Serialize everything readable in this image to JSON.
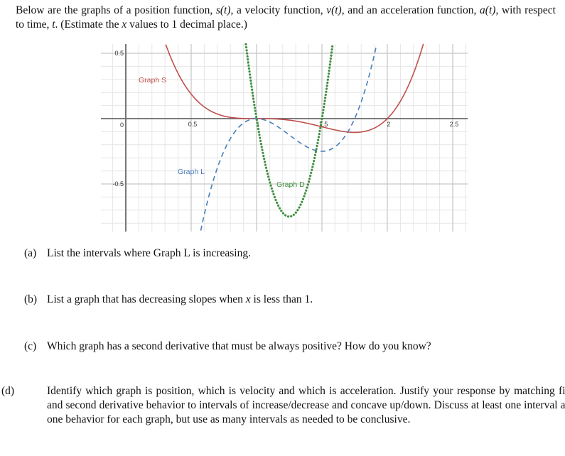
{
  "intro": {
    "line1_pre": "Below are the graphs of a position function, ",
    "s_fn": "s(t)",
    "line1_mid1": ", a velocity function, ",
    "v_fn": "v(t)",
    "line1_mid2": ", and an acceleration function, ",
    "a_fn": "a(t)",
    "line1_mid3": ", with respect to time, ",
    "t_var": "t",
    "line1_post": ". (Estimate the ",
    "x_var": "x",
    "line1_end": " values to 1 decimal place.)"
  },
  "questions": [
    {
      "label": "(a)",
      "text": "List the intervals where Graph L is increasing."
    },
    {
      "label": "(b)",
      "text_pre": "List a graph that has decreasing slopes when ",
      "var": "x",
      "text_post": " is less than 1."
    },
    {
      "label": "(c)",
      "text": "Which graph has a second derivative that must be always positive? How do you know?"
    },
    {
      "label": "(d)",
      "text": "Identify which graph is position, which is velocity and which is acceleration. Justify your response by matching first and second derivative behavior to intervals of increase/decrease and concave up/down. Discuss at least one interval and one behavior for each graph, but use as many intervals as needed to be conclusive."
    }
  ],
  "chart_data": {
    "type": "line",
    "title": "",
    "xlabel": "",
    "ylabel": "",
    "xlim": [
      -0.2,
      2.6
    ],
    "ylim": [
      -0.85,
      0.57
    ],
    "grid": true,
    "minor_grid_step": 0.1,
    "x_ticks": [
      "0.5",
      "1",
      "1.5",
      "2",
      "2.5"
    ],
    "x_tick_values": [
      0.5,
      1,
      1.5,
      2,
      2.5
    ],
    "y_ticks": [
      "0.5",
      "0",
      "-0.5"
    ],
    "y_tick_values": [
      0.5,
      0,
      -0.5
    ],
    "series": [
      {
        "name": "Graph S",
        "style": "solid",
        "color": "#c0504d",
        "formula": "(x-1)^3*(x-2)",
        "x": [
          0.3,
          0.5,
          0.75,
          1.0,
          1.25,
          1.5,
          1.75,
          2.0,
          2.2,
          2.25
        ],
        "values": [
          0.58,
          0.19,
          0.02,
          0.0,
          -0.01,
          -0.06,
          -0.11,
          0.0,
          0.35,
          0.49
        ]
      },
      {
        "name": "Graph L",
        "style": "dashed",
        "color": "#4a7ebb",
        "formula": "(x-1)^2*(4x-7)",
        "x": [
          0.55,
          0.75,
          1.0,
          1.25,
          1.5,
          1.75,
          1.9
        ],
        "values": [
          -0.97,
          -0.25,
          0.0,
          -0.13,
          -0.25,
          0.0,
          0.53
        ]
      },
      {
        "name": "Graph D",
        "style": "dotted",
        "color": "#3f8f3f",
        "formula": "12*(x-1)*(x-1.5)",
        "x": [
          0.92,
          1.0,
          1.1,
          1.25,
          1.4,
          1.5,
          1.59
        ],
        "values": [
          0.55,
          0.0,
          -0.48,
          -0.75,
          -0.48,
          0.0,
          0.54
        ]
      }
    ],
    "annotations": [
      {
        "text": "Graph S",
        "color": "#c0504d"
      },
      {
        "text": "Graph L",
        "color": "#4a7ebb"
      },
      {
        "text": "Graph D",
        "color": "#3f8f3f"
      }
    ]
  }
}
